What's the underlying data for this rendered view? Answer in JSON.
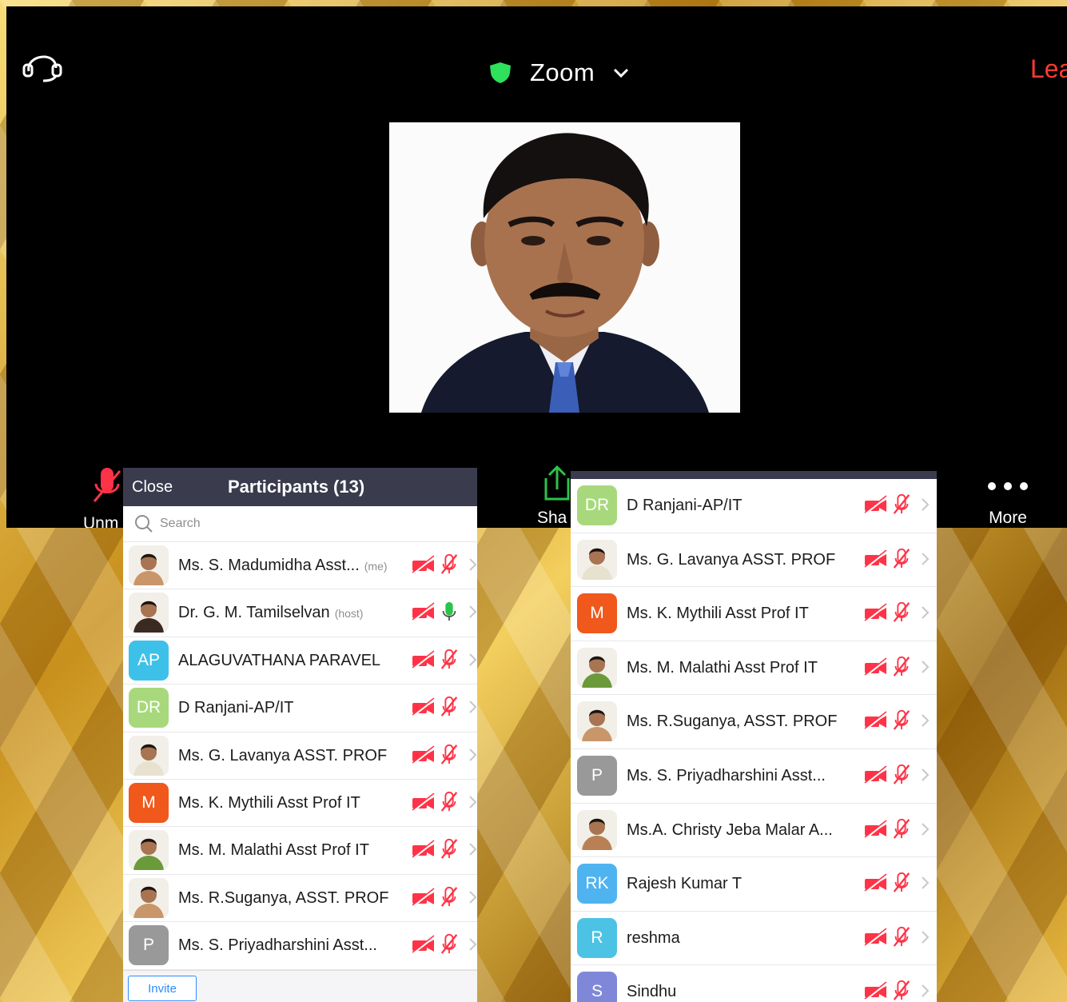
{
  "meeting": {
    "title": "Zoom",
    "leave_label": "Lea",
    "toolbar": {
      "unmute_label": "Unm",
      "share_label": "Sha",
      "more_label": "More"
    }
  },
  "panel_left": {
    "close_label": "Close",
    "title": "Participants (13)",
    "search_placeholder": "Search",
    "invite_label": "Invite",
    "participants": [
      {
        "name": "Ms. S. Madumidha Asst...",
        "tag": "(me)",
        "avatar": "photo",
        "mic": "muted"
      },
      {
        "name": "Dr. G. M. Tamilselvan",
        "tag": "(host)",
        "avatar": "photo",
        "mic": "active"
      },
      {
        "name": "ALAGUVATHANA PARAVEL",
        "tag": "",
        "avatar": "AP",
        "mic": "muted"
      },
      {
        "name": "D Ranjani-AP/IT",
        "tag": "",
        "avatar": "DR",
        "mic": "muted"
      },
      {
        "name": "Ms. G. Lavanya ASST. PROF",
        "tag": "",
        "avatar": "photo",
        "mic": "muted"
      },
      {
        "name": "Ms. K. Mythili Asst Prof IT",
        "tag": "",
        "avatar": "M",
        "mic": "muted"
      },
      {
        "name": "Ms. M. Malathi Asst Prof IT",
        "tag": "",
        "avatar": "photo",
        "mic": "muted"
      },
      {
        "name": "Ms. R.Suganya, ASST. PROF",
        "tag": "",
        "avatar": "photo",
        "mic": "muted"
      },
      {
        "name": "Ms. S. Priyadharshini Asst...",
        "tag": "",
        "avatar": "P",
        "mic": "muted"
      }
    ]
  },
  "panel_right": {
    "participants": [
      {
        "name": "D Ranjani-AP/IT",
        "avatar": "DR"
      },
      {
        "name": "Ms. G. Lavanya ASST. PROF",
        "avatar": "photo"
      },
      {
        "name": "Ms. K. Mythili Asst Prof IT",
        "avatar": "M"
      },
      {
        "name": "Ms. M. Malathi Asst Prof IT",
        "avatar": "photo"
      },
      {
        "name": "Ms. R.Suganya, ASST. PROF",
        "avatar": "photo"
      },
      {
        "name": "Ms. S. Priyadharshini Asst...",
        "avatar": "P"
      },
      {
        "name": "Ms.A. Christy Jeba Malar A...",
        "avatar": "photo"
      },
      {
        "name": "Rajesh Kumar T",
        "avatar": "RK"
      },
      {
        "name": "reshma",
        "avatar": "R"
      },
      {
        "name": "Sindhu",
        "avatar": "S"
      }
    ]
  },
  "colors": {
    "ap": "#3ec1e8",
    "dr": "#a7d97c",
    "m": "#f0581c",
    "rk": "#4fb3f0",
    "r": "#4cc3e5",
    "s": "#7f88d8",
    "muted": "#ff3347",
    "active": "#2bc34a",
    "shield": "#2ee05a",
    "leave": "#ff3b30"
  }
}
